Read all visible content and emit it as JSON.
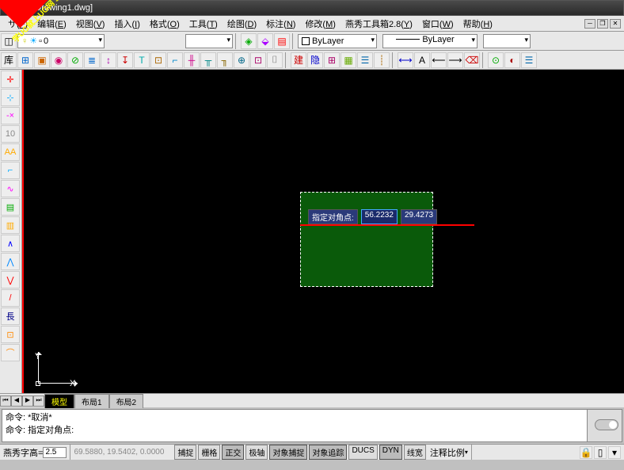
{
  "title": "2008 - [Drawing1.dwg]",
  "ribbon": "学UG就上UG网 9SUG",
  "menus": [
    {
      "label": "サ",
      "key": "F"
    },
    {
      "label": "编辑",
      "key": "E"
    },
    {
      "label": "视图",
      "key": "V"
    },
    {
      "label": "插入",
      "key": "I"
    },
    {
      "label": "格式",
      "key": "O"
    },
    {
      "label": "工具",
      "key": "T"
    },
    {
      "label": "绘图",
      "key": "D"
    },
    {
      "label": "标注",
      "key": "N"
    },
    {
      "label": "修改",
      "key": "M"
    },
    {
      "label": "燕秀工具箱2.8",
      "key": "Y"
    },
    {
      "label": "窗口",
      "key": "W"
    },
    {
      "label": "帮助",
      "key": "H"
    }
  ],
  "layer_dd": "0",
  "bylayer": "ByLayer",
  "linetype": "ByLayer",
  "tooltip": {
    "label": "指定对角点:",
    "val1": "56.2232",
    "val2": "29.4273"
  },
  "tabs": [
    {
      "name": "模型",
      "active": true
    },
    {
      "name": "布局1",
      "active": false
    },
    {
      "name": "布局2",
      "active": false
    }
  ],
  "cmd": {
    "line1": "命令:  *取消*",
    "line2": "命令: 指定对角点:"
  },
  "status": {
    "prefix": "燕秀字高=",
    "val": "2.5",
    "coords": "69.5880, 19.5402, 0.0000",
    "btns": [
      "捕捉",
      "栅格",
      "正交",
      "极轴",
      "对象捕捉",
      "对象追踪",
      "DUCS",
      "DYN",
      "线宽"
    ],
    "active": [
      2,
      4,
      5,
      7
    ],
    "annotation": "注释比例"
  },
  "ucs": {
    "x": "X",
    "y": "Y"
  }
}
